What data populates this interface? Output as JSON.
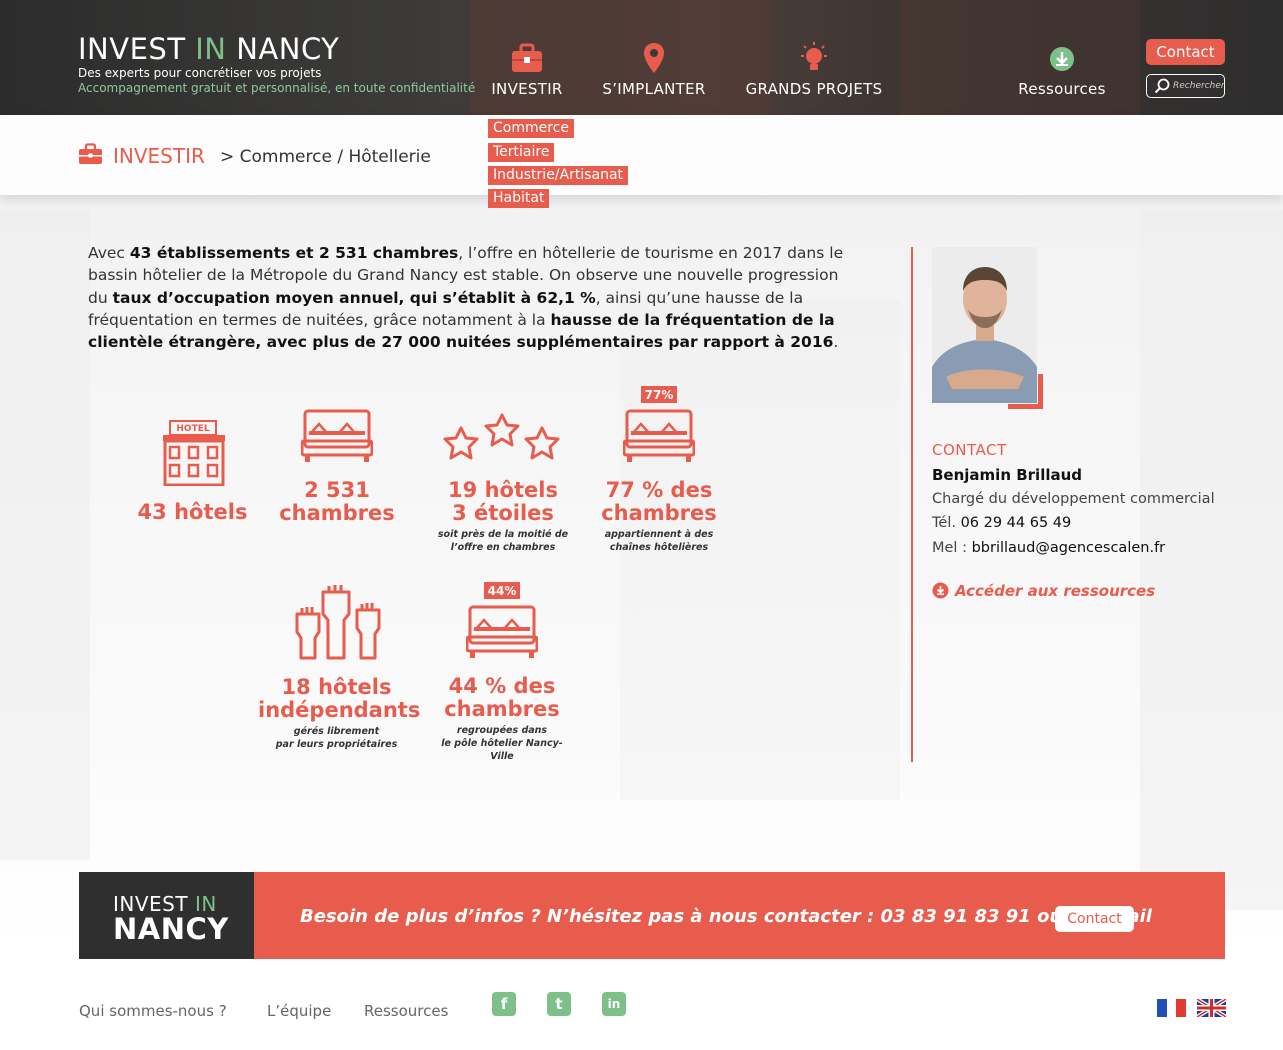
{
  "brand": {
    "logo_invest": "INVEST",
    "logo_in": "IN",
    "logo_nancy": "NANCY",
    "tagline": "Des experts pour concrétiser vos projets",
    "subtagline": "Accompagnement gratuit et personnalisé, en toute confidentialité"
  },
  "nav": {
    "items": [
      {
        "label": "INVESTIR",
        "icon": "briefcase-icon"
      },
      {
        "label": "S’IMPLANTER",
        "icon": "map-pin-icon"
      },
      {
        "label": "GRANDS PROJETS",
        "icon": "lightbulb-icon"
      },
      {
        "label": "Ressources",
        "icon": "download-icon"
      }
    ],
    "contact_label": "Contact",
    "search_placeholder": "Rechercher",
    "submenu": [
      "Commerce",
      "Tertiaire",
      "Industrie/Artisanat",
      "Habitat"
    ]
  },
  "breadcrumb": {
    "section": "INVESTIR",
    "path": "> Commerce / Hôtellerie"
  },
  "intro": {
    "p1": "Avec ",
    "b1": "43 établissements et 2 531 chambres",
    "p2": ", l’offre en hôtellerie de tourisme en 2017 dans le bassin hôtelier de la Métropole du Grand Nancy est stable. On observe une nouvelle progression du ",
    "b2": "taux d’occupation moyen annuel, qui s’établit à 62,1 %",
    "p3": ", ainsi qu’une hausse de la fréquentation en termes de nuitées, grâce notamment à la ",
    "b3": "hausse de la fréquentation de la clientèle étrangère, avec plus de 27 000 nuitées supplémentaires par rapport à 2016",
    "p4": "."
  },
  "stats": {
    "hotels": {
      "line1": "43 hôtels",
      "sign": "HOTEL"
    },
    "rooms": {
      "line1": "2 531",
      "line2": "chambres"
    },
    "three_star": {
      "line1": "19 hôtels",
      "line2": "3 étoiles",
      "note1": "soit près de la moitié de",
      "note2": "l’offre en chambres"
    },
    "chains": {
      "badge": "77%",
      "line1": "77 % des",
      "line2": "chambres",
      "note1": "appartiennent à des",
      "note2": "chaînes hôtelières"
    },
    "independent": {
      "line1": "18 hôtels",
      "line2": "indépendants",
      "note1": "gérés librement",
      "note2": "par leurs propriétaires"
    },
    "nancy_ville": {
      "badge": "44%",
      "line1": "44 % des",
      "line2": "chambres",
      "note1": "regroupées dans",
      "note2": "le pôle hôtelier Nancy-Ville"
    }
  },
  "contact": {
    "label": "CONTACT",
    "name": "Benjamin Brillaud",
    "role": "Chargé du développement commercial",
    "tel_label": "Tél.",
    "tel": "06 29 44 65 49",
    "mail_label": "Mel :",
    "mail": "bbrillaud@agencescalen.fr",
    "resources_link": "Accéder aux ressources"
  },
  "banner": {
    "logo_invest": "INVEST",
    "logo_in": "IN",
    "logo_nancy": "NANCY",
    "text": "Besoin de plus d’infos ? N’hésitez pas à nous contacter : 03 83 91 83 91 ou par mail",
    "button": "Contact"
  },
  "footer": {
    "links": [
      "Qui sommes-nous ?",
      "L’équipe",
      "Ressources"
    ],
    "social": [
      {
        "icon": "facebook-icon",
        "glyph": "f"
      },
      {
        "icon": "twitter-icon",
        "glyph": "t"
      },
      {
        "icon": "linkedin-icon",
        "glyph": "in"
      }
    ],
    "languages": [
      "french-flag-icon",
      "uk-flag-icon"
    ]
  },
  "colors": {
    "accent": "#e85c4e",
    "green": "#7fc08a",
    "dark": "#2f2f2f"
  }
}
